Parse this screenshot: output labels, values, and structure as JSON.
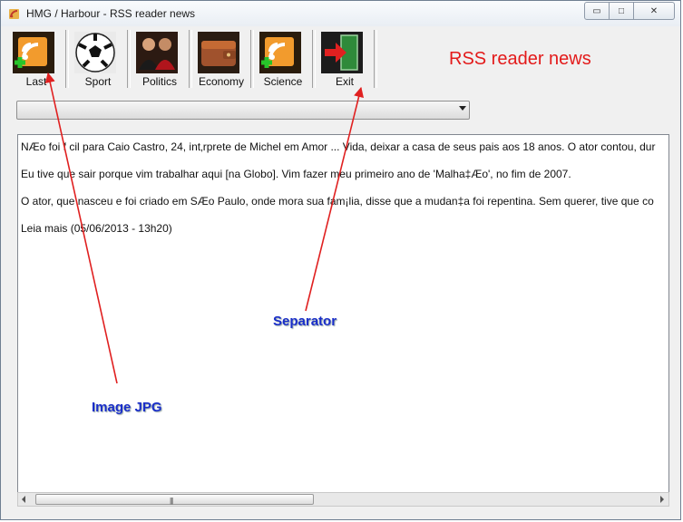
{
  "window": {
    "title": "HMG / Harbour -  RSS reader news",
    "minimize_label": "▭",
    "maximize_label": "□",
    "close_label": "✕"
  },
  "toolbar": {
    "buttons": [
      {
        "label": "Last",
        "icon": "rss-feed-add-icon"
      },
      {
        "label": "Sport",
        "icon": "soccer-ball-icon"
      },
      {
        "label": "Politics",
        "icon": "people-icon"
      },
      {
        "label": "Economy",
        "icon": "wallet-icon"
      },
      {
        "label": "Science",
        "icon": "rss-feed-add-icon"
      },
      {
        "label": "Exit",
        "icon": "exit-door-icon"
      }
    ]
  },
  "heading": "RSS reader news",
  "combo": {
    "value": ""
  },
  "content": {
    "paragraphs": [
      "NÆo foi f cil para Caio Castro, 24, int‚rprete de Michel em Amor ... Vida, deixar a casa de seus pais aos 18 anos. O ator contou, dur",
      "Eu tive que sair porque vim trabalhar aqui [na Globo]. Vim fazer meu primeiro ano de 'Malha‡Æo', no fim de 2007.",
      "O ator, que nasceu e foi criado em SÆo Paulo, onde mora sua fam¡lia, disse que a mudan‡a foi repentina. Sem querer, tive que co",
      "Leia mais (05/06/2013 - 13h20)"
    ]
  },
  "scrollbar": {
    "grip": "|||"
  },
  "annotations": {
    "image_jpg": "Image JPG",
    "separator": "Separator"
  },
  "colors": {
    "heading": "#e31a1a",
    "annotation": "#1a2ec9",
    "arrow": "#e02020"
  }
}
